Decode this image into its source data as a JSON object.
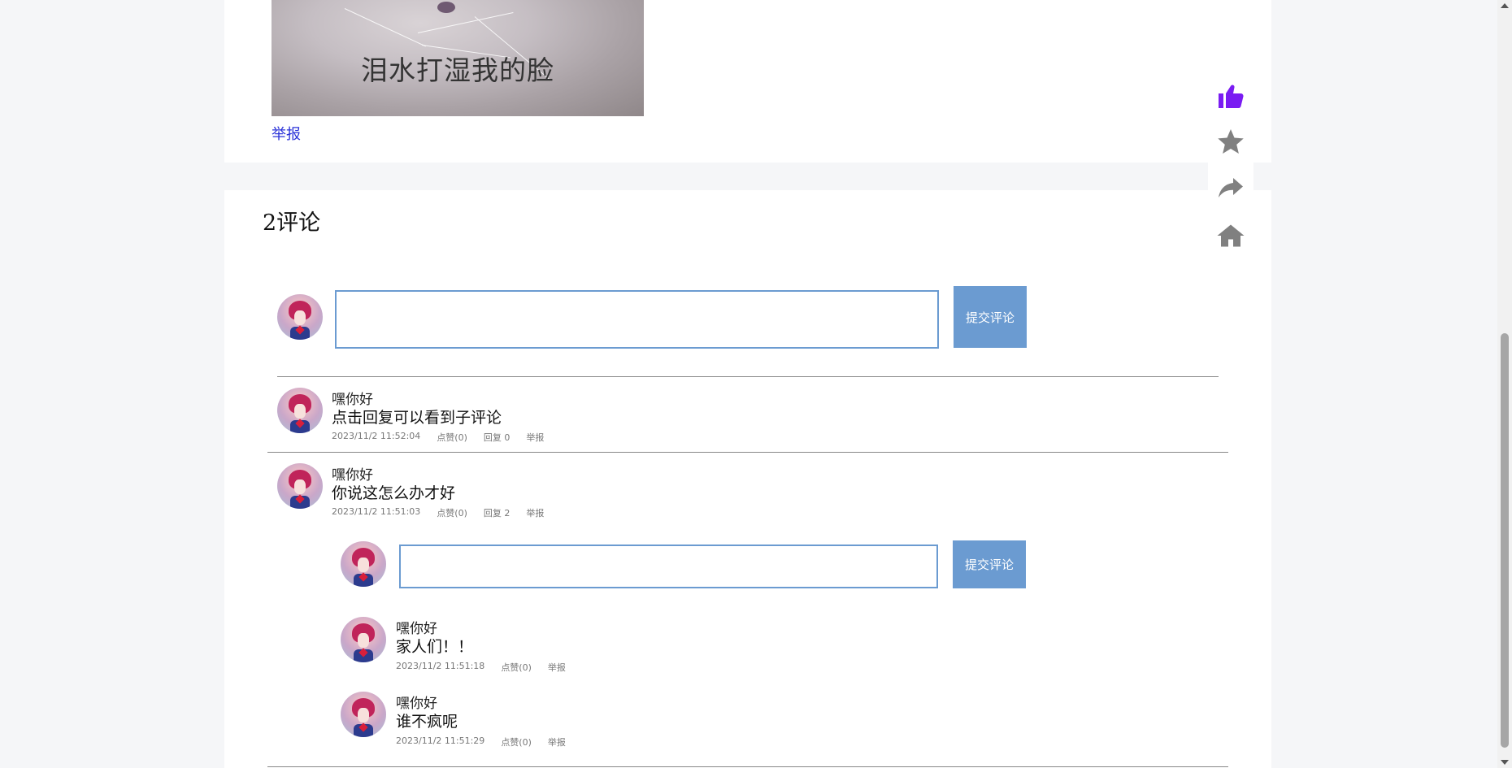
{
  "post": {
    "image_caption": "泪水打湿我的脸",
    "report_label": "举报"
  },
  "comments_section": {
    "count_title": "2评论",
    "input_placeholder": "",
    "submit_label": "提交评论"
  },
  "comments": [
    {
      "user": "嘿你好",
      "text": "点击回复可以看到子评论",
      "time": "2023/11/2 11:52:04",
      "like": "点赞(0)",
      "reply": "回复 0",
      "report": "举报"
    },
    {
      "user": "嘿你好",
      "text": "你说这怎么办才好",
      "time": "2023/11/2 11:51:03",
      "like": "点赞(0)",
      "reply": "回复 2",
      "report": "举报",
      "reply_form": {
        "submit_label": "提交评论"
      },
      "replies": [
        {
          "user": "嘿你好",
          "text": "家人们！！",
          "time": "2023/11/2 11:51:18",
          "like": "点赞(0)",
          "report": "举报"
        },
        {
          "user": "嘿你好",
          "text": "谁不疯呢",
          "time": "2023/11/2 11:51:29",
          "like": "点赞(0)",
          "report": "举报"
        }
      ]
    }
  ],
  "side_actions": {
    "icons": [
      "thumbs-up-icon",
      "star-icon",
      "share-icon",
      "home-icon"
    ],
    "like_color": "#7a1cf2",
    "icon_color": "#808080"
  },
  "colors": {
    "accent": "#6b9bd1",
    "link": "#2a32d8",
    "page_bg": "#f5f6f8"
  }
}
